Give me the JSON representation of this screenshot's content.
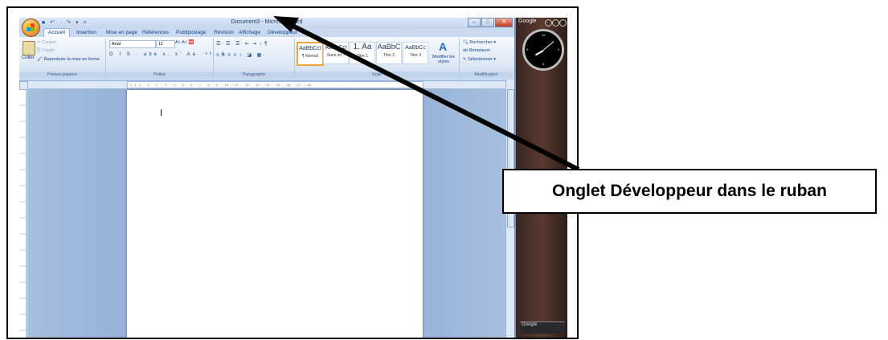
{
  "window": {
    "title": "Document3 - Microsoft Word",
    "quick_access": "■ ↶ · ↷ ▾ ="
  },
  "tabs": [
    "Accueil",
    "Insertion",
    "Mise en page",
    "Références",
    "Publipostage",
    "Révision",
    "Affichage",
    "Développeur"
  ],
  "clipboard": {
    "paste": "Coller",
    "cut": "Couper",
    "copy": "Copier",
    "format_painter": "Reproduire la mise en forme",
    "label": "Presse-papiers"
  },
  "font": {
    "name": "Arial",
    "size": "11",
    "format_row": "G  I  S · abe x, x' Aa· ᵃᵇ· A·",
    "label": "Police"
  },
  "paragraph": {
    "row1": "☰· ☰· ☰·  ⇤ ⇥  ↕ ¶",
    "row2": "≡ ≡ ≡ ≡  ↕·  ◪· ▦·",
    "label": "Paragraphe"
  },
  "styles": {
    "items": [
      {
        "sample": "AaBbCcI",
        "name": "¶ Normal"
      },
      {
        "sample": "AaBbCcI",
        "name": "Sans int..."
      },
      {
        "sample": "1. Aa",
        "name": "Titre 1"
      },
      {
        "sample": "AaBbC",
        "name": "Titre 2"
      },
      {
        "sample": "AaBbCc",
        "name": "Titre 3"
      }
    ],
    "modify": "Modifier les styles",
    "label": "Style"
  },
  "editing": {
    "find": "Rechercher",
    "replace": "Remplacer",
    "select": "Sélectionner",
    "label": "Modification"
  },
  "ruler": "· 2 · 1 · 1 · · · 1 · · · 2 · · · 3 · · · 4 · · · 5 · · · 6 · · · 7 · · · 8 · · · 9 · · · 10 · · · 11 · · · 12 · · · 13 · · · 14 · · · 15 · · · 16 · · · 17 · · · 18 ·",
  "sidebar": {
    "top_label": "Google",
    "bottom_label": "Google"
  },
  "annotation": {
    "text": "Onglet Développeur dans le ruban"
  }
}
